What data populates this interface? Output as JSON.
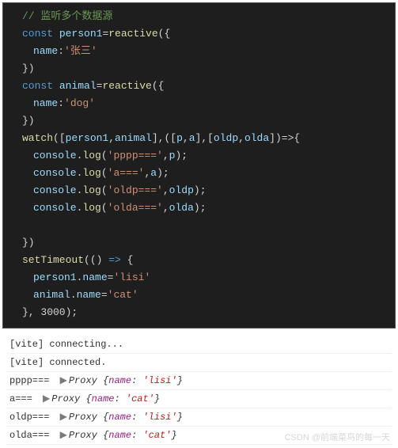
{
  "editor": {
    "comment": "// 监听多个数据源",
    "l2": {
      "kw": "const",
      "v": "person1",
      "eq": "=",
      "fn": "reactive",
      "open": "({"
    },
    "l3": {
      "key": "name",
      "colon": ":",
      "val": "'张三'"
    },
    "l4": {
      "close": "})"
    },
    "l5": {
      "kw": "const",
      "v": "animal",
      "eq": "=",
      "fn": "reactive",
      "open": "({"
    },
    "l6": {
      "key": "name",
      "colon": ":",
      "val": "'dog'"
    },
    "l7": {
      "close": "})"
    },
    "l8": {
      "fn": "watch",
      "args": "([",
      "a1": "person1",
      "c": ",",
      "a2": "animal",
      "mid": "],([",
      "p": "p",
      "a": "a",
      "mid2": "],[",
      "op": "oldp",
      "oa": "olda",
      "end": "])=>{"
    },
    "l9": {
      "obj": "console",
      "dot": ".",
      "fn": "log",
      "open": "(",
      "s": "'pppp==='",
      "c": ",",
      "v": "p",
      "close": ");"
    },
    "l10": {
      "obj": "console",
      "dot": ".",
      "fn": "log",
      "open": "(",
      "s": "'a==='",
      "c": ",",
      "v": "a",
      "close": ");"
    },
    "l11": {
      "obj": "console",
      "dot": ".",
      "fn": "log",
      "open": "(",
      "s": "'oldp==='",
      "c": ",",
      "v": "oldp",
      "close": ");"
    },
    "l12": {
      "obj": "console",
      "dot": ".",
      "fn": "log",
      "open": "(",
      "s": "'olda==='",
      "c": ",",
      "v": "olda",
      "close": ");"
    },
    "blank": " ",
    "l14": {
      "close": "})"
    },
    "l15": {
      "fn": "setTimeout",
      "open": "(() ",
      "arrow": "=>",
      "brace": " {"
    },
    "l16": {
      "obj": "person1",
      "dot": ".",
      "prop": "name",
      "eq": "=",
      "val": "'lisi'"
    },
    "l17": {
      "obj": "animal",
      "dot": ".",
      "prop": "name",
      "eq": "=",
      "val": "'cat'"
    },
    "l18": {
      "close": "}, 3000);"
    }
  },
  "console": {
    "rows": [
      {
        "text": "[vite] connecting..."
      },
      {
        "text": "[vite] connected."
      },
      {
        "label": "pppp=== ",
        "proxy": "Proxy ",
        "key1": "name",
        "val1": "'lisi'"
      },
      {
        "label": "a=== ",
        "proxy": "Proxy ",
        "key1": "name",
        "val1": "'cat'"
      },
      {
        "label": "oldp=== ",
        "proxy": "Proxy ",
        "key1": "name",
        "val1": "'lisi'"
      },
      {
        "label": "olda=== ",
        "proxy": "Proxy ",
        "key1": "name",
        "val1": "'cat'"
      }
    ]
  },
  "watermark": "CSDN @前端菜鸟的每一天"
}
